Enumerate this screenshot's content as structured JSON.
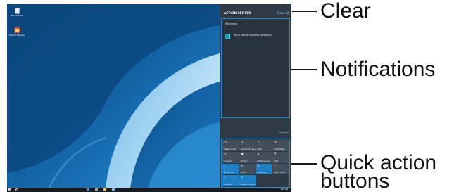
{
  "desktop": {
    "icons": [
      {
        "name": "recycle-bin-icon",
        "label": "Recycle Bin"
      },
      {
        "name": "samsung-icon",
        "label": "Online Experts"
      }
    ]
  },
  "action_center": {
    "title": "ACTION CENTER",
    "clear_label": "Clear all",
    "notification_group": "Wireless",
    "notification_text": "Wi-Fi Sense requires attention.",
    "collapse_label": "Collapse",
    "quick_actions": [
      {
        "label": "Tablet mode",
        "icon": "tablet-icon",
        "active": false
      },
      {
        "label": "Connected Devi...",
        "icon": "connect-icon",
        "active": false
      },
      {
        "label": "Note",
        "icon": "note-icon",
        "active": false
      },
      {
        "label": "All settings",
        "icon": "gear-icon",
        "active": false
      },
      {
        "label": "Connect",
        "icon": "connect-icon",
        "active": false
      },
      {
        "label": "Project",
        "icon": "project-icon",
        "active": false
      },
      {
        "label": "Battery saver",
        "icon": "battery-icon",
        "active": false
      },
      {
        "label": "VPN",
        "icon": "vpn-icon",
        "active": false
      },
      {
        "label": "Bluetooth",
        "icon": "bluetooth-icon",
        "active": true
      },
      {
        "label": "100%",
        "icon": "brightness-icon",
        "active": false
      },
      {
        "label": "WalkWay",
        "icon": "wifi-icon",
        "active": true
      },
      {
        "label": "Quiet hours",
        "icon": "moon-icon",
        "active": false
      },
      {
        "label": "Location",
        "icon": "location-icon",
        "active": true
      },
      {
        "label": "Airplane mode",
        "icon": "airplane-icon",
        "active": true
      }
    ]
  },
  "taskbar": {
    "clock": "1:46 AM"
  },
  "callouts": {
    "clear": "Clear",
    "notifications": "Notifications",
    "quick_action_line1": "Quick action",
    "quick_action_line2": "buttons"
  },
  "colors": {
    "accent": "#1a8bd8",
    "action_center_bg": "#2e3a45",
    "wallpaper": "#0d4f86"
  }
}
